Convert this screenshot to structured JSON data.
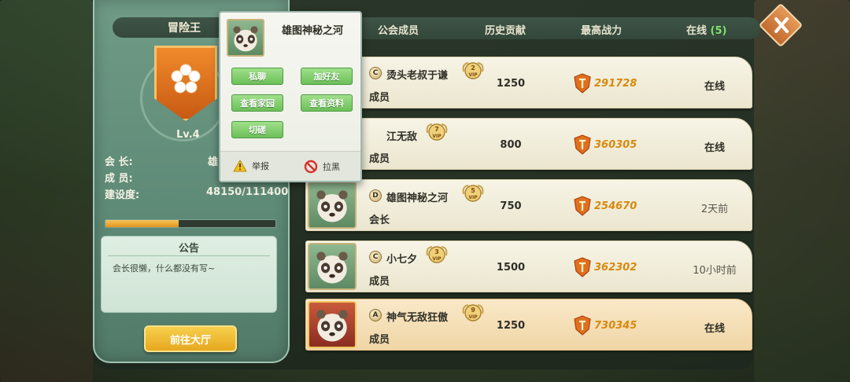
{
  "guild": {
    "name": "冒险王",
    "level": "Lv.4",
    "leader_label": "会  长:",
    "leader_value": "雄",
    "members_label": "成  员:",
    "build_label": "建设度:",
    "build_value": "48150/111400",
    "build_progress": 0.432,
    "notice_title": "公告",
    "notice_text": "会长很懒，什么都没有写~",
    "hall_button": "前往大厅"
  },
  "tabs": {
    "members": "公会成员",
    "history": "历史贡献",
    "power": "最高战力",
    "online": "在线",
    "online_count": "(5)"
  },
  "members": [
    {
      "rank": "C",
      "name": "烫头老叔于谦",
      "vip": "2",
      "role": "成员",
      "contribution": "1250",
      "power": "291728",
      "status": "在线"
    },
    {
      "rank": "",
      "name": "江无敌",
      "vip": "7",
      "role": "成员",
      "contribution": "800",
      "power": "360305",
      "status": "在线"
    },
    {
      "rank": "D",
      "name": "雄图神秘之河",
      "vip": "5",
      "role": "会长",
      "contribution": "750",
      "power": "254670",
      "status": "2天前"
    },
    {
      "rank": "C",
      "name": "小七夕",
      "vip": "3",
      "role": "成员",
      "contribution": "1500",
      "power": "362302",
      "status": "10小时前"
    },
    {
      "rank": "A",
      "name": "神气无敌狂傲",
      "vip": "9",
      "role": "成员",
      "contribution": "1250",
      "power": "730345",
      "status": "在线"
    }
  ],
  "popup": {
    "name": "雄图神秘之河",
    "chat": "私聊",
    "add_friend": "加好友",
    "view_home": "查看家园",
    "view_profile": "查看资料",
    "spar": "切磋",
    "report": "举报",
    "block": "拉黑"
  },
  "colors": {
    "online_green": "#7fe06a",
    "power_orange": "#d8890f",
    "button_green": "#6cbf58",
    "button_gold": "#e6a820"
  }
}
